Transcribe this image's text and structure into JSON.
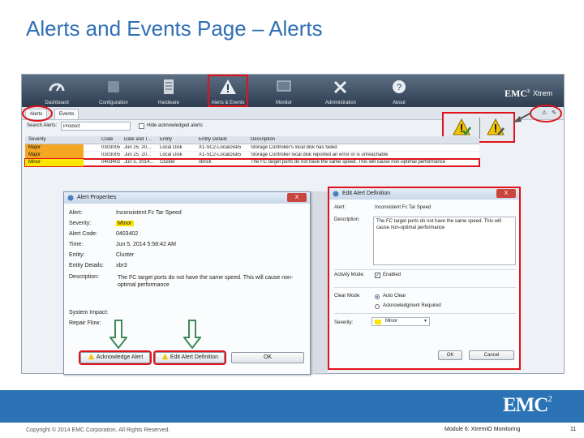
{
  "slide": {
    "title": "Alerts and Events Page – Alerts",
    "copyright": "Copyright © 2014 EMC Corporation. All Rights Reserved.",
    "module": "Module 6: XtremIO Monitoring",
    "page_number": "11",
    "footer_logo": "EMC",
    "footer_logo_sup": "2"
  },
  "app": {
    "logo": "EMC",
    "logo_sup": "2",
    "product": "Xtrem",
    "nav": [
      {
        "label": "Dashboard",
        "icon": "gauge-icon"
      },
      {
        "label": "Configuration",
        "icon": "configuration-icon"
      },
      {
        "label": "Hardware",
        "icon": "hardware-icon"
      },
      {
        "label": "Alerts & Events",
        "icon": "alert-triangle-icon"
      },
      {
        "label": "Monitor",
        "icon": "monitor-icon"
      },
      {
        "label": "Administration",
        "icon": "tools-icon"
      },
      {
        "label": "About",
        "icon": "help-icon"
      }
    ],
    "tabs": {
      "alerts": "Alerts",
      "events": "Events"
    },
    "search": {
      "label": "Search Alerts:",
      "value": "Product",
      "hide_ack_label": "Hide acknowledged alerts"
    },
    "table": {
      "headers": [
        "Severity",
        "Code",
        "Date and T...",
        "Entity",
        "Entity Details",
        "Description"
      ],
      "rows": [
        [
          "Major",
          "0303005",
          "Jun 25, 20...",
          "Local Disk",
          "X1-SC2-LocalDisk5",
          "Storage Controller's local disk has failed"
        ],
        [
          "Major",
          "0303005",
          "Jun 25, 20...",
          "Local Disk",
          "X1-SC2-LocalDisk5",
          "Storage Controller local disk reported an error or is unreachable"
        ],
        [
          "Minor",
          "0403402",
          "Jun 5, 2014...",
          "Cluster",
          "xbrick",
          "The FC target ports do not have the same speed. This will cause non-optimal performance"
        ]
      ]
    }
  },
  "alert_properties": {
    "title": "Alert Properties",
    "close_label": "X",
    "fields": [
      {
        "label": "Alert:",
        "value": "Inconsistent Fc Tar Speed"
      },
      {
        "label": "Severity:",
        "value": "Minor"
      },
      {
        "label": "Alert Code:",
        "value": "0403402"
      },
      {
        "label": "Time:",
        "value": "Jun 5, 2014 5:58:42 AM"
      },
      {
        "label": "Entity:",
        "value": "Cluster"
      },
      {
        "label": "Entity Details:",
        "value": "xbr3"
      },
      {
        "label": "Description:",
        "value": ""
      }
    ],
    "description": "The FC target ports do not have the same speed. This will cause non-optimal performance",
    "system_impact_label": "System Impact:",
    "repair_flow_label": "Repair Flow:",
    "buttons": {
      "acknowledge": "Acknowledge Alert",
      "edit": "Edit Alert Definition",
      "ok": "OK"
    }
  },
  "edit_definition": {
    "title": "Edit Alert Definition",
    "close_label": "X",
    "alert_label": "Alert:",
    "alert_value": "Inconsistent Fc Tar Speed",
    "description_label": "Description:",
    "description_value": "The FC target ports do not have the same speed. This will cause non-optimal performance",
    "activity_mode_label": "Activity Mode:",
    "enabled_label": "Enabled",
    "clear_mode_label": "Clear Mode:",
    "auto_clear_label": "Auto Clear",
    "ack_required_label": "Acknowledgment Required",
    "severity_label": "Severity:",
    "severity_value": "Minor",
    "ok_label": "OK",
    "cancel_label": "Cancel"
  },
  "colors": {
    "title_blue": "#2f6fb5",
    "highlight_red": "#e0121b",
    "major_orange": "#f5a623",
    "minor_yellow": "#ffe600",
    "footer_blue": "#2b73b4",
    "arrow_green": "#3f8a57"
  }
}
